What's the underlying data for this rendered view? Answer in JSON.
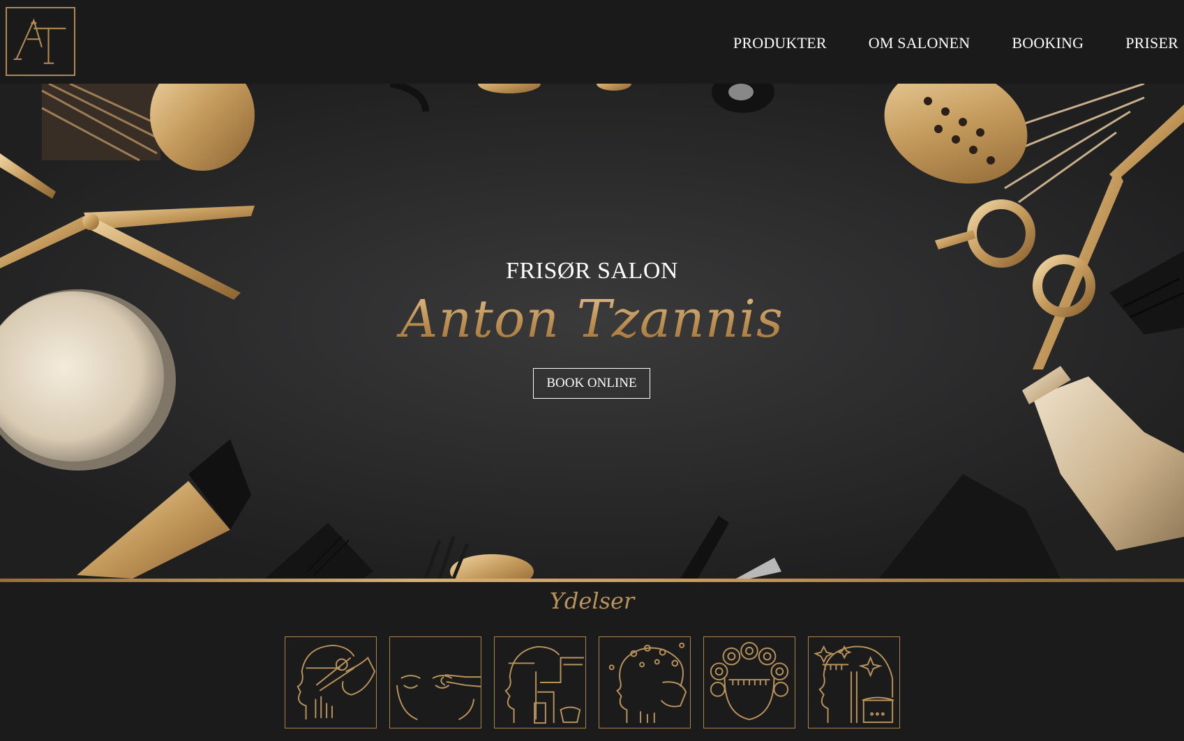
{
  "brand": {
    "logo_text": "AT",
    "logo_color": "#b08a55"
  },
  "nav": {
    "items": [
      {
        "label": "PRODUKTER"
      },
      {
        "label": "OM SALONEN"
      },
      {
        "label": "BOOKING"
      },
      {
        "label": "PRISER"
      }
    ]
  },
  "hero": {
    "subtitle": "FRISØR SALON",
    "title": "Anton Tzannis",
    "cta_label": "BOOK ONLINE"
  },
  "services": {
    "title": "Ydelser",
    "icons": [
      "hair-cut-icon",
      "eyebrow-treatment-icon",
      "hair-wash-icon",
      "scalp-massage-icon",
      "curlers-icon",
      "hair-care-icon"
    ]
  },
  "colors": {
    "background": "#1c1b1c",
    "gold": "#c2975c",
    "text": "#ffffff"
  }
}
